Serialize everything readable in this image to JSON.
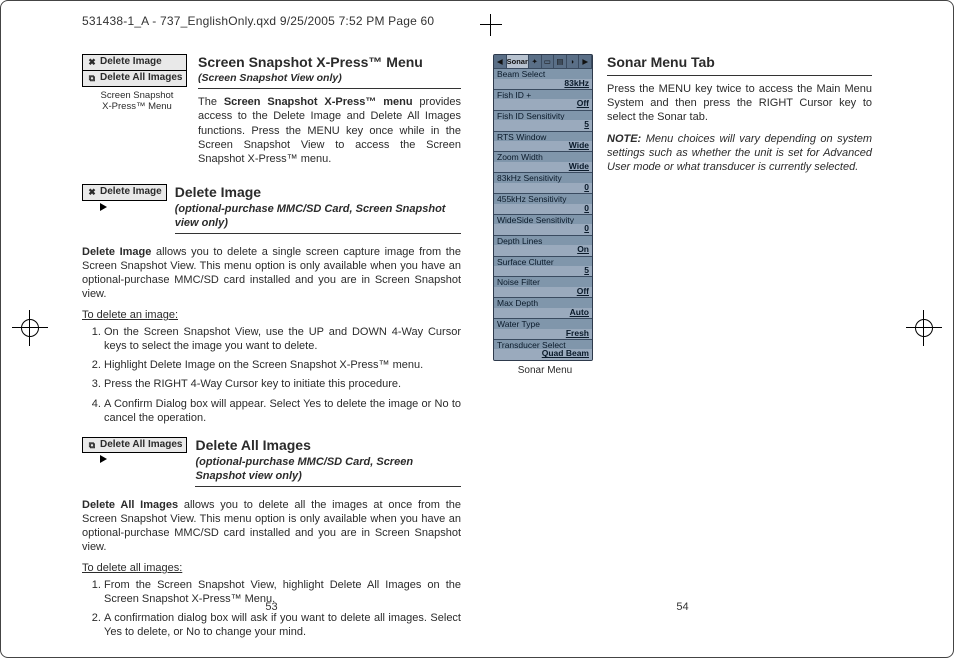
{
  "slug": "531438-1_A - 737_EnglishOnly.qxd  9/25/2005  7:52 PM  Page 60",
  "left": {
    "sect1": {
      "title": "Screen Snapshot X-Press™ Menu",
      "sub": "(Screen Snapshot View only)",
      "menu_items": [
        "Delete Image",
        "Delete All Images"
      ],
      "caption": "Screen Snapshot\nX-Press™ Menu",
      "body_pre": "The ",
      "body_bold": "Screen Snapshot X-Press™ menu",
      "body_post": " provides access to the Delete Image and Delete All Images functions.  Press the MENU key once while in the Screen Snapshot View to access the Screen Snapshot X-Press™ menu."
    },
    "sect2": {
      "title": "Delete Image",
      "sub": "(optional-purchase MMC/SD Card, Screen Snapshot view only)",
      "menu_item": "Delete Image",
      "lead_bold": "Delete Image",
      "lead_rest": " allows you to delete a single screen capture image from the Screen Snapshot View. This menu option is only available when you have an optional-purchase MMC/SD card installed and you are in Screen Snapshot view.",
      "subhead": "To delete an image:",
      "steps": [
        "On the Screen Snapshot View, use the UP and DOWN 4-Way Cursor keys to select the image you want to delete.",
        "Highlight Delete Image on the Screen Snapshot X-Press™ menu.",
        "Press the RIGHT 4-Way Cursor key to initiate this procedure.",
        "A Confirm Dialog box will appear.  Select Yes to delete the image or No to cancel the operation."
      ]
    },
    "sect3": {
      "title": "Delete All Images",
      "sub": "(optional-purchase MMC/SD Card, Screen Snapshot view only)",
      "menu_item": "Delete All Images",
      "lead_bold": "Delete All Images",
      "lead_rest": " allows you to delete all the images at once from the Screen Snapshot View. This menu option is only available when you have an optional-purchase MMC/SD card installed and you are in Screen Snapshot view.",
      "subhead": "To delete all images:",
      "steps": [
        "From the Screen Snapshot View, highlight Delete All Images on the Screen Snapshot X-Press™ Menu.",
        "A confirmation dialog box will ask if you want to delete all images. Select Yes to delete, or No to change your mind."
      ]
    },
    "pgnum": "53"
  },
  "right": {
    "title": "Sonar Menu Tab",
    "body": "Press the MENU key twice to access the Main Menu System and then press the RIGHT Cursor key to select the Sonar tab.",
    "note_label": "NOTE:",
    "note_body": " Menu choices will vary depending on system settings such as whether the unit is set for Advanced User mode or what transducer is currently selected.",
    "caption": "Sonar Menu",
    "tabs_active": "Sonar",
    "menu": [
      {
        "lbl": "Beam Select",
        "val": "83kHz"
      },
      {
        "lbl": "Fish ID +",
        "val": "Off"
      },
      {
        "lbl": "Fish ID Sensitivity",
        "val": "5"
      },
      {
        "lbl": "RTS Window",
        "val": "Wide"
      },
      {
        "lbl": "Zoom Width",
        "val": "Wide"
      },
      {
        "lbl": "83kHz Sensitivity",
        "val": "0"
      },
      {
        "lbl": "455kHz Sensitivity",
        "val": "0"
      },
      {
        "lbl": "WideSide Sensitivity",
        "val": "0"
      },
      {
        "lbl": "Depth Lines",
        "val": "On"
      },
      {
        "lbl": "Surface Clutter",
        "val": "5"
      },
      {
        "lbl": "Noise Filter",
        "val": "Off"
      },
      {
        "lbl": "Max Depth",
        "val": "Auto"
      },
      {
        "lbl": "Water Type",
        "val": "Fresh"
      },
      {
        "lbl": "Transducer Select",
        "val": "Quad Beam"
      }
    ],
    "pgnum": "54"
  }
}
